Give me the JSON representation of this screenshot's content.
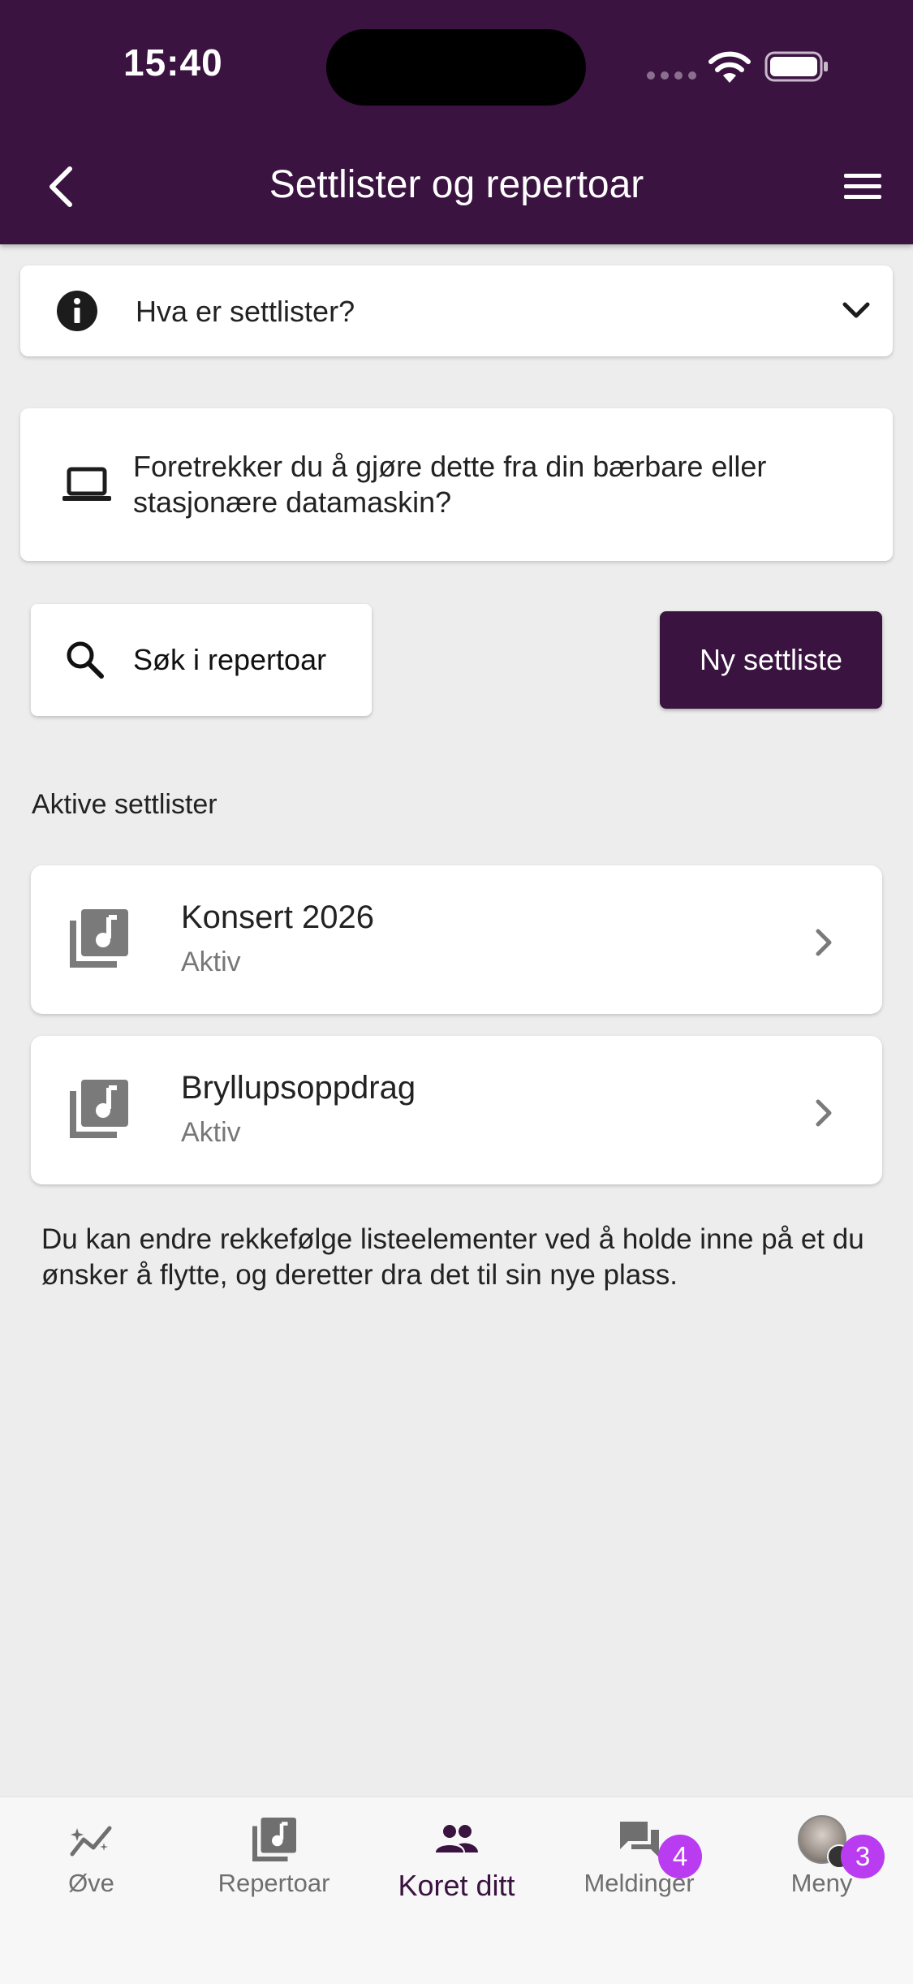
{
  "status_bar": {
    "time": "15:40"
  },
  "header": {
    "title": "Settlister og repertoar"
  },
  "info_panel": {
    "label": "Hva er settlister?"
  },
  "desktop_hint": {
    "text": "Foretrekker du å gjøre dette fra din bærbare eller stasjonære datamaskin?"
  },
  "actions": {
    "search_label": "Søk i repertoar",
    "new_label": "Ny settliste"
  },
  "section": {
    "label": "Aktive settlister"
  },
  "setlists": [
    {
      "title": "Konsert 2026",
      "status": "Aktiv"
    },
    {
      "title": "Bryllupsoppdrag",
      "status": "Aktiv"
    }
  ],
  "hint": {
    "text": "Du kan endre rekkefølge listeelementer ved å holde inne på et du ønsker å flytte, og deretter dra det til sin nye plass."
  },
  "tabs": [
    {
      "label": "Øve",
      "icon": "trend-icon",
      "active": false
    },
    {
      "label": "Repertoar",
      "icon": "music-library-icon",
      "active": false
    },
    {
      "label": "Koret ditt",
      "icon": "group-icon",
      "active": true
    },
    {
      "label": "Meldinger",
      "icon": "chat-icon",
      "active": false,
      "badge": "4"
    },
    {
      "label": "Meny",
      "icon": "avatar",
      "active": false,
      "badge": "3"
    }
  ],
  "colors": {
    "primary": "#3a1340",
    "badge": "#b93cf0",
    "background": "#ededed"
  }
}
